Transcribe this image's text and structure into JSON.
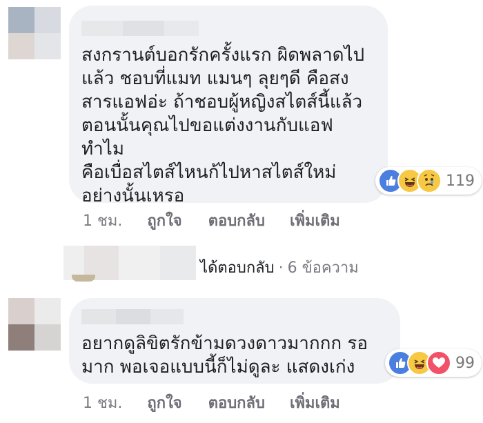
{
  "comments": [
    {
      "text": "สงกรานต์บอกรักครั้งแรก ผิดพลาดไป\nแล้ว ชอบที่แมท แมนๆ ลุยๆดี คือสง\nสารแอฟอ่ะ ถ้าชอบผู้หญิงสไตส์นี้แล้ว\nตอนนั้นคุณไปขอแต่งงานกับแอฟ\nทำไม\nคือเบื่อสไตส์ไหนก้ไปหาสไตส์ใหม่\nอย่างนั้นเหรอ",
      "reactions": [
        "like",
        "haha",
        "sad"
      ],
      "reaction_count": "119",
      "time": "1 ชม.",
      "actions": [
        "ถูกใจ",
        "ตอบกลับ",
        "เพิ่มเติม"
      ]
    },
    {
      "text": "อยากดูลิขิตรักข้ามดวงดาวมากกก รอ\nมาก พอเจอแบบนี้ก็ไม่ดูละ แสดงเก่ง",
      "reactions": [
        "like",
        "haha",
        "love"
      ],
      "reaction_count": "99",
      "time": "1 ชม.",
      "actions": [
        "ถูกใจ",
        "ตอบกลับ",
        "เพิ่มเติม"
      ]
    }
  ],
  "replies": {
    "label": "ได้ตอบกลับ",
    "separator": "·",
    "count_text": "6 ข้อความ"
  },
  "colors": {
    "bubble": "#f1f2f6",
    "like": "#4a7fe0",
    "haha": "#f7c843",
    "love": "#f25268",
    "meta": "#7a7a82"
  }
}
